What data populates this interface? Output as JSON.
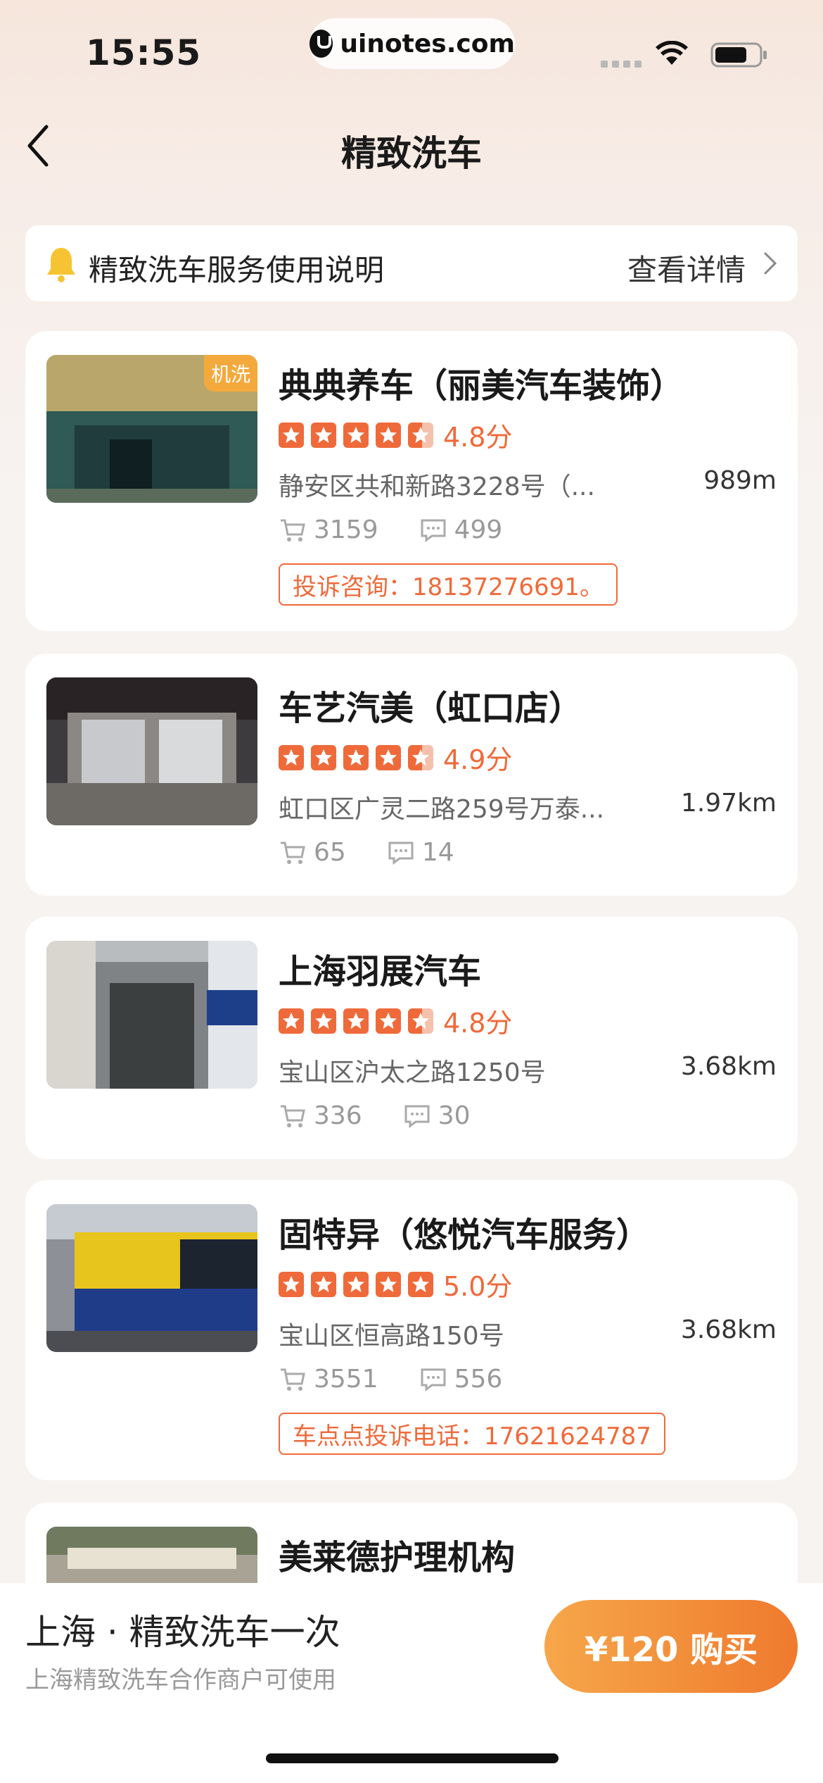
{
  "status_bar": {
    "time": "15:55",
    "url": "uinotes.com",
    "icons": [
      "signal-icon",
      "wifi-icon",
      "battery-icon"
    ]
  },
  "nav": {
    "title": "精致洗车",
    "back_icon": "chevron-left-icon"
  },
  "notice": {
    "text": "精致洗车服务使用说明",
    "link": "查看详情",
    "icon": "bell-icon"
  },
  "shops": [
    {
      "name": "典典养车（丽美汽车装饰）",
      "tag": "机洗",
      "score": "4.8分",
      "address": "静安区共和新路3228号（...",
      "distance": "989m",
      "orders": "3159",
      "comments": "499",
      "complaint": "投诉咨询：18137276691。"
    },
    {
      "name": "车艺汽美（虹口店）",
      "score": "4.9分",
      "address": "虹口区广灵二路259号万泰...",
      "distance": "1.97km",
      "orders": "65",
      "comments": "14"
    },
    {
      "name": "上海羽展汽车",
      "score": "4.8分",
      "address": "宝山区沪太之路1250号",
      "distance": "3.68km",
      "orders": "336",
      "comments": "30"
    },
    {
      "name": "固特异（悠悦汽车服务）",
      "score": "5.0分",
      "address": "宝山区恒高路150号",
      "distance": "3.68km",
      "orders": "3551",
      "comments": "556",
      "complaint": "车点点投诉电话：17621624787"
    },
    {
      "name": "美莱德护理机构"
    }
  ],
  "bottom": {
    "title": "上海 · 精致洗车一次",
    "subtitle": "上海精致洗车合作商户可使用",
    "buy_label": "¥120 购买"
  },
  "colors": {
    "accent": "#ef6a3a",
    "tag": "#f4a93c",
    "button_start": "#f6a74a",
    "button_end": "#ef7a2e"
  }
}
